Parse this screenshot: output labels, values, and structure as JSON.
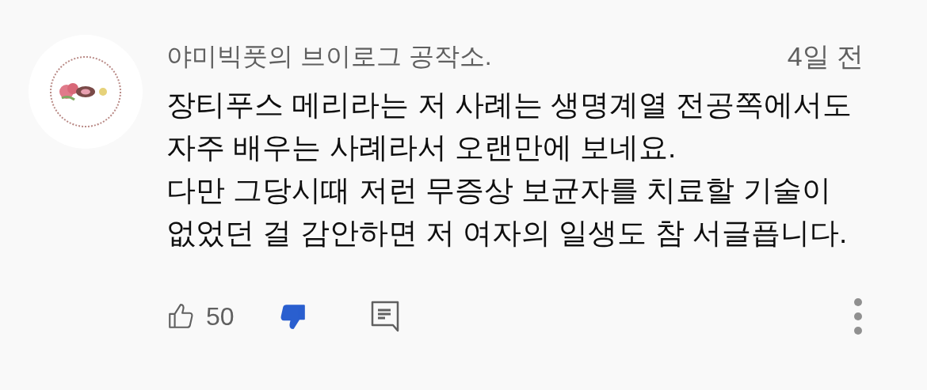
{
  "comment": {
    "author": "야미빅풋의 브이로그 공작소.",
    "time": "4일 전",
    "paragraphs": [
      "장티푸스 메리라는 저 사례는 생명계열 전공쪽에서도 자주 배우는 사례라서 오랜만에 보네요.",
      "다만 그당시때 저런 무증상 보균자를 치료할 기술이 없었던 걸 감안하면 저 여자의 일생도 참 서글픕니다."
    ],
    "like_count": "50",
    "liked": false,
    "disliked": true
  }
}
